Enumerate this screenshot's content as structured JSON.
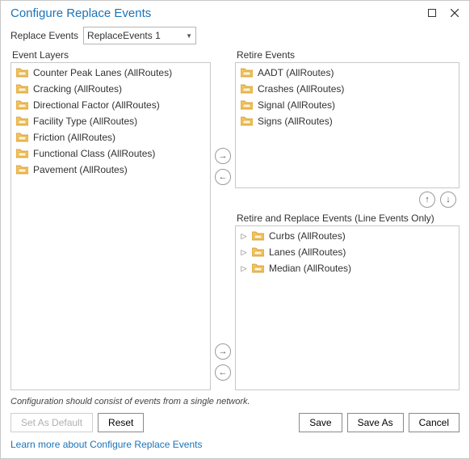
{
  "window": {
    "title": "Configure Replace Events"
  },
  "selector": {
    "label": "Replace Events",
    "value": "ReplaceEvents 1"
  },
  "panels": {
    "event_layers_label": "Event Layers",
    "retire_events_label": "Retire Events",
    "retire_replace_label": "Retire and Replace Events (Line Events Only)"
  },
  "event_layers": [
    {
      "label": "Counter Peak Lanes (AllRoutes)"
    },
    {
      "label": "Cracking (AllRoutes)"
    },
    {
      "label": "Directional Factor (AllRoutes)"
    },
    {
      "label": "Facility Type (AllRoutes)"
    },
    {
      "label": "Friction (AllRoutes)"
    },
    {
      "label": "Functional Class (AllRoutes)"
    },
    {
      "label": "Pavement (AllRoutes)"
    }
  ],
  "retire_events": [
    {
      "label": "AADT (AllRoutes)"
    },
    {
      "label": "Crashes (AllRoutes)"
    },
    {
      "label": "Signal (AllRoutes)"
    },
    {
      "label": "Signs (AllRoutes)"
    }
  ],
  "retire_replace": [
    {
      "label": "Curbs (AllRoutes)"
    },
    {
      "label": "Lanes (AllRoutes)"
    },
    {
      "label": "Median (AllRoutes)"
    }
  ],
  "footer_note": "Configuration should consist of events from a single network.",
  "buttons": {
    "set_default": "Set As Default",
    "reset": "Reset",
    "save": "Save",
    "save_as": "Save As",
    "cancel": "Cancel"
  },
  "link_text": "Learn more about Configure Replace Events"
}
